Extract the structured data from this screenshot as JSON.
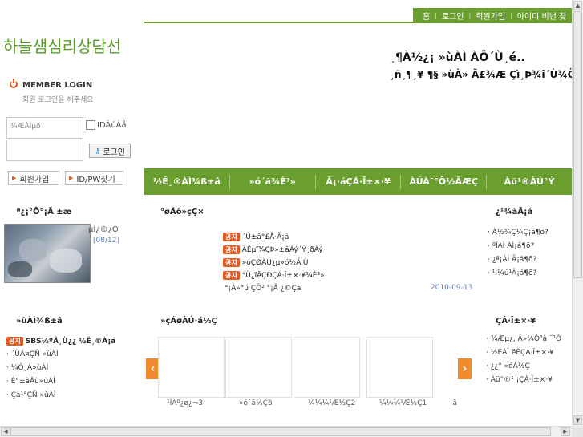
{
  "topnav": {
    "home": "홈",
    "login": "로그인",
    "join": "회원가입",
    "find": "아이디 비번 찾"
  },
  "site_title": "하늘샘심리상담선",
  "headline": {
    "line1": "¸¶À½¿¡ »ùÀÌ ÀÖ´Ù¸é..",
    "line2": "¸ñ¸¶¸¥ ¶§ »ùÀ» Ã£¾Æ Çì¸Þ¾î´Ù¾Ö¾Æµµ"
  },
  "login": {
    "title": "MEMBER LOGIN",
    "subtitle": "회원 로그인을 해주세요",
    "id_placeholder": "¾ÆÀÌµð",
    "save_id_label": "IDÀúÀå",
    "login_button": "로그인",
    "join_button": "회원가입",
    "find_button": "ID/PW찾기"
  },
  "menubar": [
    "½É¸®ÀÌ¾ß±â",
    "»ó´ã¾È³»",
    "Ã¡·áÇÁ·Î±×·¥",
    "ÀÚÀ¯°Ô½ÃÆÇ",
    "Àü¹®ÀÚ°Ý"
  ],
  "sections": {
    "photo": "ª¿¡°Ô°¡Ã ±æ",
    "notice": "°øÁö»çÇ×",
    "qna": "¿¹¾àÃ¡á",
    "counsel": "»ùÀÌ¾ß±â",
    "gallery": "»çÁøÀÚ·á½Ç",
    "program": "ÇÁ·Î±×·¥"
  },
  "photo": {
    "caption": "µÎ¿©¿Õ",
    "date": "[08/12]"
  },
  "notices": [
    {
      "badge": "공지",
      "text": "´Ù±â°£Å·Ã¡á"
    },
    {
      "badge": "공지",
      "text": "ÃÊµî¾ÇÞ»±âÁý´Ý¸ðÁý"
    },
    {
      "badge": "공지",
      "text": "»óÇØÀÚ¿µ»ó½ÃÌÙ"
    },
    {
      "badge": "공지",
      "text": "°Ü¿ïÄÇÐÇÁ·Î±×·¥¾È³»"
    }
  ],
  "notice_extra": "°¡À»°ú ÇÔ² °¡Ã ¿©Çà",
  "notice_date": "2010-09-13",
  "qna_items": [
    "À½¾Ç¼Ç¡á¶õ?",
    "ºÎÀÌ ÀÌ¡á¶õ?",
    "¿ª¡ÀÌ Ã¡á¶õ?",
    "¹Ì¼ú¹Ã¡á¶õ?"
  ],
  "counsel_items": [
    {
      "badge": "공지",
      "text": "SBS½ºÅ¸Ù¿¿ ½Ê¸®À¡á"
    },
    {
      "badge": "",
      "text": "´ÜÁ¤ÇÑ »ùÀÌ"
    },
    {
      "badge": "",
      "text": "¼Ò¸Á»ùÀÌ"
    },
    {
      "badge": "",
      "text": "È°±âÂù»ùÀÌ"
    },
    {
      "badge": "",
      "text": "Çà¹°ÇÑ »ùÀÌ"
    }
  ],
  "gallery_labels": [
    "¹ÎÀº¿ø¿¬3",
    "»ó´ã½Ç6",
    "¼¼¼¹Æ½Ç2",
    "¼¼¼¹Æ½Ç1",
    "´ã"
  ],
  "program_items": [
    "¾Æµ¿, Ã»¼Ò³â ¨¹Ó",
    "½ÉÀÎ ëÈ­ÇÁ·Î±×·¥",
    "¿¿° »óÀ½Ç",
    "Àü°®¹ ¡ÇÁ·Î±×·¥"
  ],
  "gallery_arrows": {
    "prev": "‹",
    "next": "›"
  }
}
